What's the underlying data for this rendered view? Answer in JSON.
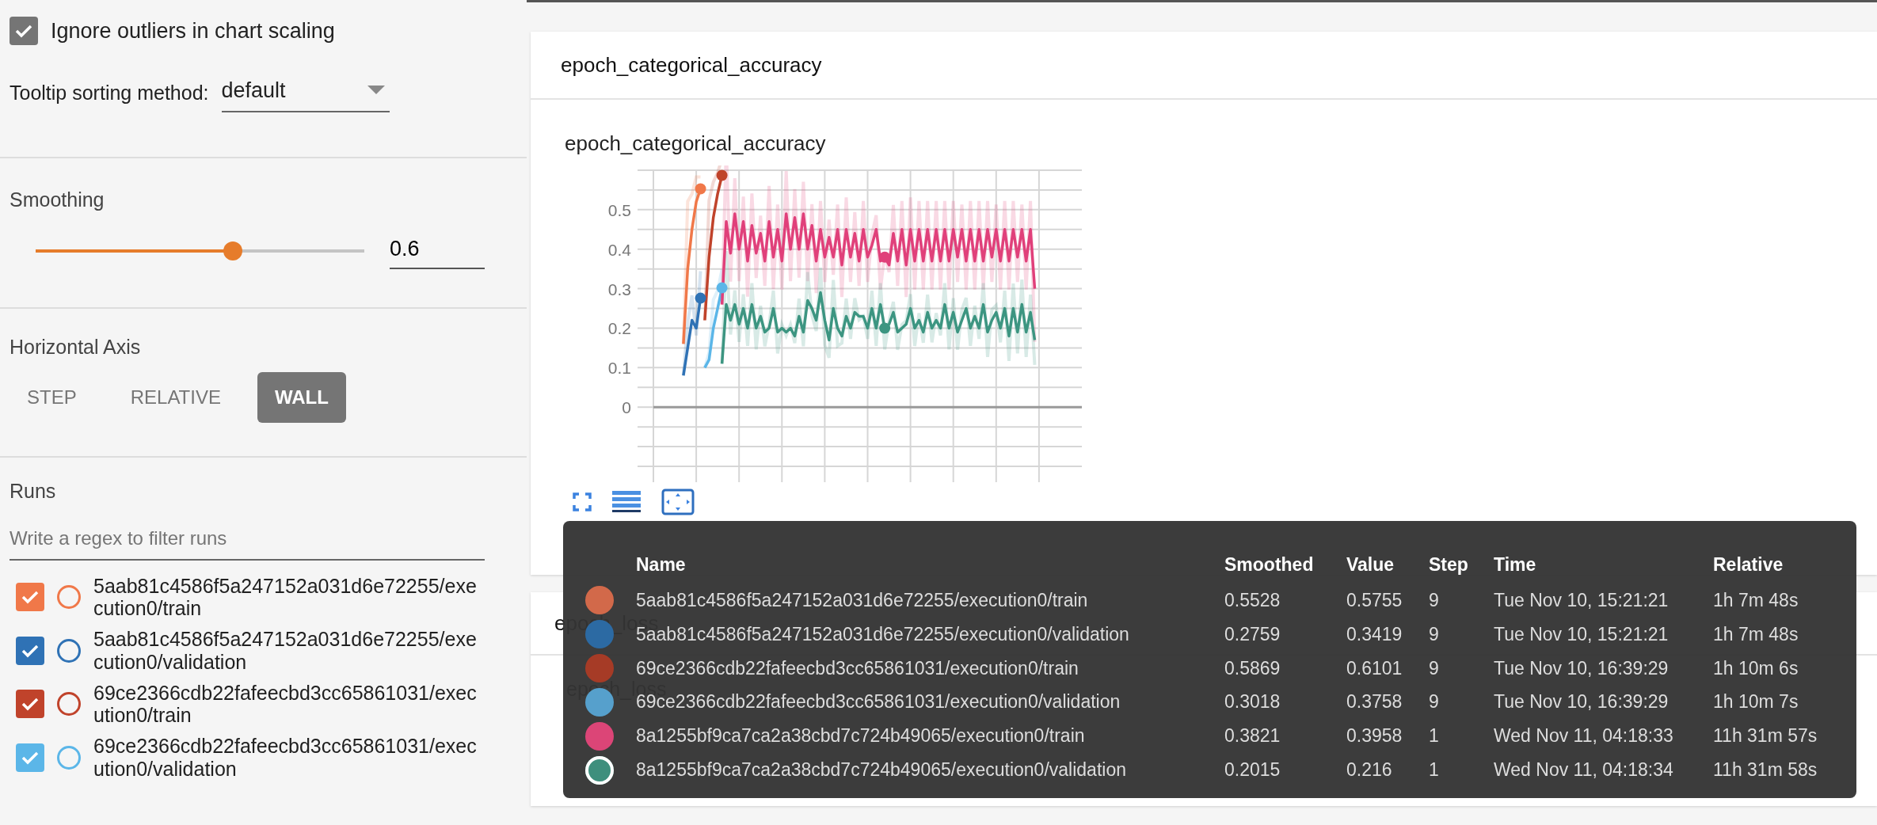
{
  "sidebar": {
    "ignore_outliers": {
      "label": "Ignore outliers in chart scaling",
      "checked": true
    },
    "tooltip_sorting": {
      "label": "Tooltip sorting method:",
      "value": "default"
    },
    "smoothing": {
      "label": "Smoothing",
      "level": 0.6,
      "value": "0.6"
    },
    "horizontal_axis": {
      "label": "Horizontal Axis",
      "options": [
        {
          "label": "STEP",
          "selected": false
        },
        {
          "label": "RELATIVE",
          "selected": false
        },
        {
          "label": "WALL",
          "selected": true
        }
      ]
    },
    "runs": {
      "label": "Runs",
      "filter": {
        "placeholder": "Write a regex to filter runs"
      },
      "items": [
        {
          "name": "5aab81c4586f5a247152a031d6e72255/execution0/train",
          "checked": true,
          "color": "#f07849"
        },
        {
          "name": "5aab81c4586f5a247152a031d6e72255/execution0/validation",
          "checked": true,
          "color": "#2f72b5"
        },
        {
          "name": "69ce2366cdb22fafeecbd3cc65861031/execution0/train",
          "checked": true,
          "color": "#c0432b"
        },
        {
          "name": "69ce2366cdb22fafeecbd3cc65861031/execution0/validation",
          "checked": true,
          "color": "#5bb6e8"
        }
      ]
    }
  },
  "cards": [
    {
      "title": "epoch_categorical_accuracy",
      "chart_title": "epoch_categorical_accuracy",
      "y_tick_labels": [
        "0.5",
        "0.4",
        "0.3",
        "0.2",
        "0.1",
        "0"
      ]
    },
    {
      "title": "epoch_loss",
      "chart_title": "epoch_loss"
    }
  ],
  "tooltip": {
    "columns": [
      "Name",
      "Smoothed",
      "Value",
      "Step",
      "Time",
      "Relative"
    ],
    "rows": [
      {
        "color": "#d2694a",
        "selected": false,
        "cells": [
          "5aab81c4586f5a247152a031d6e72255/execution0/train",
          "0.5528",
          "0.5755",
          "9",
          "Tue Nov 10, 15:21:21",
          "1h 7m 48s"
        ]
      },
      {
        "color": "#2c6aa3",
        "selected": false,
        "cells": [
          "5aab81c4586f5a247152a031d6e72255/execution0/validation",
          "0.2759",
          "0.3419",
          "9",
          "Tue Nov 10, 15:21:21",
          "1h 7m 48s"
        ]
      },
      {
        "color": "#a63b26",
        "selected": false,
        "cells": [
          "69ce2366cdb22fafeecbd3cc65861031/execution0/train",
          "0.5869",
          "0.6101",
          "9",
          "Tue Nov 10, 16:39:29",
          "1h 10m 6s"
        ]
      },
      {
        "color": "#56a0cc",
        "selected": false,
        "cells": [
          "69ce2366cdb22fafeecbd3cc65861031/execution0/validation",
          "0.3018",
          "0.3758",
          "9",
          "Tue Nov 10, 16:39:29",
          "1h 10m 7s"
        ]
      },
      {
        "color": "#dc4577",
        "selected": false,
        "cells": [
          "8a1255bf9ca7ca2a38cbd7c724b49065/execution0/train",
          "0.3821",
          "0.3958",
          "1",
          "Wed Nov 11, 04:18:33",
          "11h 31m 57s"
        ]
      },
      {
        "color": "#3e8f7d",
        "selected": true,
        "cells": [
          "8a1255bf9ca7ca2a38cbd7c724b49065/execution0/validation",
          "0.2015",
          "0.216",
          "1",
          "Wed Nov 11, 04:18:34",
          "11h 31m 58s"
        ]
      }
    ]
  }
}
